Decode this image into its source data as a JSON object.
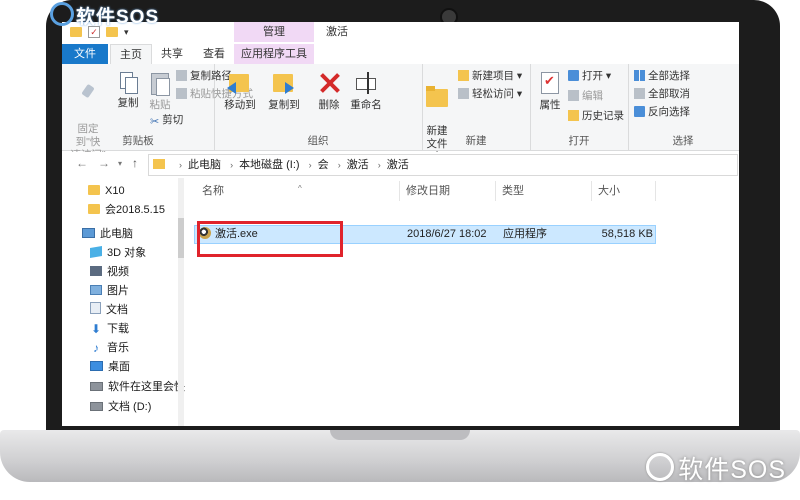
{
  "watermarks": {
    "top_left": "软件SOS",
    "bottom_right": "软件SOS"
  },
  "titlebar": {
    "context_tab": "管理",
    "window_title": "激活"
  },
  "tabs": {
    "file": "文件",
    "home": "主页",
    "share": "共享",
    "view": "查看",
    "app_tools": "应用程序工具"
  },
  "ribbon": {
    "clipboard": {
      "label": "剪贴板",
      "pin": "固定到\"快\n速访问\"",
      "copy": "复制",
      "paste": "粘贴",
      "copy_path": "复制路径",
      "paste_shortcut": "粘贴快捷方式",
      "cut": "剪切"
    },
    "organize": {
      "label": "组织",
      "move_to": "移动到",
      "copy_to": "复制到",
      "delete": "删除",
      "rename": "重命名"
    },
    "new": {
      "label": "新建",
      "new_folder": "新建\n文件夹",
      "new_item": "新建项目",
      "easy_access": "轻松访问"
    },
    "open": {
      "label": "打开",
      "properties": "属性",
      "open": "打开",
      "edit": "编辑",
      "history": "历史记录"
    },
    "select": {
      "label": "选择",
      "select_all": "全部选择",
      "select_none": "全部取消",
      "invert": "反向选择"
    }
  },
  "address": {
    "crumbs": [
      "此电脑",
      "本地磁盘 (I:)",
      "会",
      "激活",
      "激活"
    ]
  },
  "navpane": {
    "items": [
      {
        "label": "X10",
        "icon": "folder-icon"
      },
      {
        "label": "会2018.5.15",
        "icon": "folder-icon"
      },
      {
        "label": "此电脑",
        "icon": "computer-icon"
      },
      {
        "label": "3D 对象",
        "icon": "3d-objects-icon"
      },
      {
        "label": "视频",
        "icon": "video-icon"
      },
      {
        "label": "图片",
        "icon": "pictures-icon"
      },
      {
        "label": "文档",
        "icon": "documents-icon"
      },
      {
        "label": "下载",
        "icon": "download-icon"
      },
      {
        "label": "音乐",
        "icon": "music-icon"
      },
      {
        "label": "桌面",
        "icon": "desktop-icon"
      },
      {
        "label": "软件在这里会快",
        "icon": "drive-icon"
      },
      {
        "label": "文档 (D:)",
        "icon": "drive-icon"
      }
    ]
  },
  "content": {
    "columns": {
      "name": "名称",
      "modified": "修改日期",
      "type": "类型",
      "size": "大小"
    },
    "files": [
      {
        "name": "激活.exe",
        "modified": "2018/6/27 18:02",
        "type": "应用程序",
        "size": "58,518 KB"
      }
    ]
  },
  "colors": {
    "file_tab": "#1979ca",
    "context_tab": "#f1d9f5",
    "selection": "#cce8ff",
    "highlight_box": "#e0232b"
  }
}
